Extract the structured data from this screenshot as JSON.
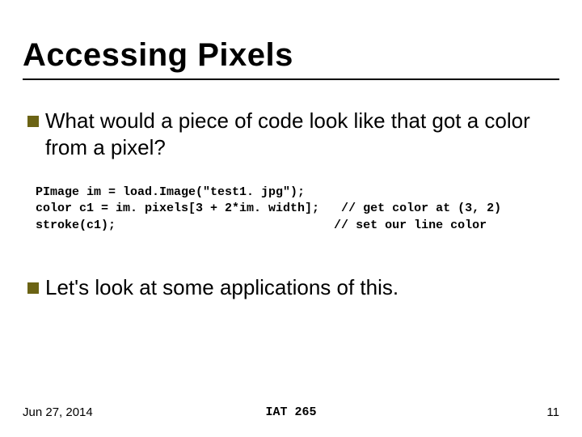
{
  "title": "Accessing Pixels",
  "bullets": [
    "What would a piece of code look like that got a color from a pixel?",
    "Let's look at some applications of this."
  ],
  "code": "PImage im = load.Image(\"test1. jpg\");\ncolor c1 = im. pixels[3 + 2*im. width];   // get color at (3, 2)\nstroke(c1);                              // set our line color",
  "footer": {
    "date": "Jun 27, 2014",
    "course": "IAT 265",
    "page": "11"
  }
}
